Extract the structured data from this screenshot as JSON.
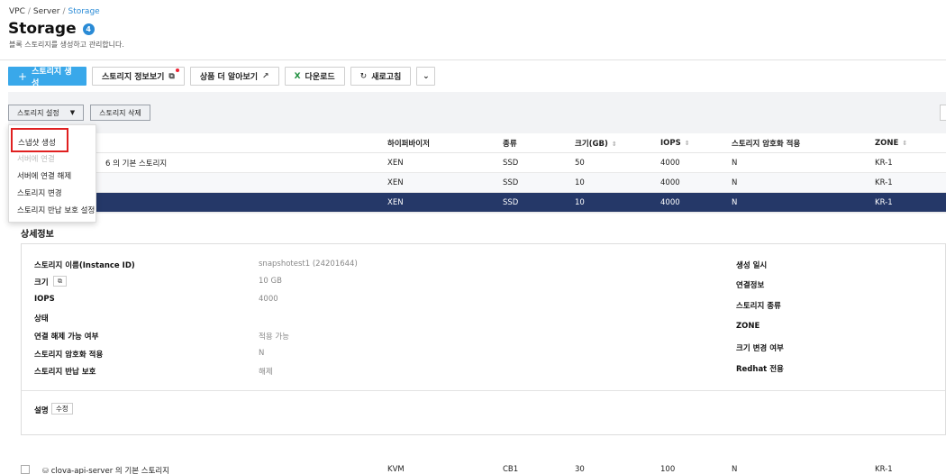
{
  "breadcrumb": {
    "item1": "VPC",
    "item2": "Server",
    "current": "Storage",
    "sep": "/"
  },
  "header": {
    "title": "Storage",
    "count": "4",
    "subtitle": "블록 스토리지를 생성하고 관리합니다."
  },
  "toolbar": {
    "create_label": "스토리지 생성",
    "create_icon": "+",
    "info_label": "스토리지 정보보기",
    "learn_label": "상품 더 알아보기",
    "download_label": "다운로드",
    "download_icon": "X",
    "refresh_label": "새로고침",
    "more_icon": "⌄"
  },
  "sub_toolbar": {
    "settings_label": "스토리지 설정",
    "settings_caret": "▼",
    "delete_label": "스토리지 삭제"
  },
  "dropdown": {
    "items": [
      "스냅샷 생성",
      "서버에 연결",
      "서버에 연결 해제",
      "스토리지 변경",
      "스토리지 반납 보호 설정"
    ]
  },
  "table": {
    "columns": [
      "하이퍼바이저",
      "종류",
      "크기(GB)",
      "IOPS",
      "스토리지 암호화 적용",
      "ZONE"
    ],
    "sort_icon": "⇕",
    "rows": [
      {
        "name": "6 의 기본 스토리지",
        "hypervisor": "XEN",
        "type": "SSD",
        "size": "50",
        "iops": "4000",
        "encrypted": "N",
        "zone": "KR-1"
      },
      {
        "name": "",
        "hypervisor": "XEN",
        "type": "SSD",
        "size": "10",
        "iops": "4000",
        "encrypted": "N",
        "zone": "KR-1"
      },
      {
        "name": "",
        "hypervisor": "XEN",
        "type": "SSD",
        "size": "10",
        "iops": "4000",
        "encrypted": "N",
        "zone": "KR-1"
      }
    ]
  },
  "detail": {
    "title": "상세정보",
    "left": [
      {
        "label": "스토리지 이름(Instance ID)",
        "value": "snapshotest1 (24201644)"
      },
      {
        "label": "크기",
        "value": "10 GB"
      },
      {
        "label": "IOPS",
        "value": "4000"
      },
      {
        "label": "상태",
        "value": ""
      },
      {
        "label": "연결 해제 가능 여부",
        "value": "적용 가능"
      },
      {
        "label": "스토리지 암호화 적용",
        "value": "N"
      },
      {
        "label": "스토리지 반납 보호",
        "value": "해제"
      }
    ],
    "right": [
      "생성 일시",
      "연결정보",
      "스토리지 종류",
      "ZONE",
      "크기 변경 여부",
      "Redhat 전용"
    ],
    "description_label": "설명",
    "edit_label": "수정"
  },
  "bottom_row": {
    "name": "clova-api-server 의 기본 스토리지",
    "hypervisor": "KVM",
    "type": "CB1",
    "size": "30",
    "iops": "100",
    "encrypted": "N",
    "zone": "KR-1"
  }
}
